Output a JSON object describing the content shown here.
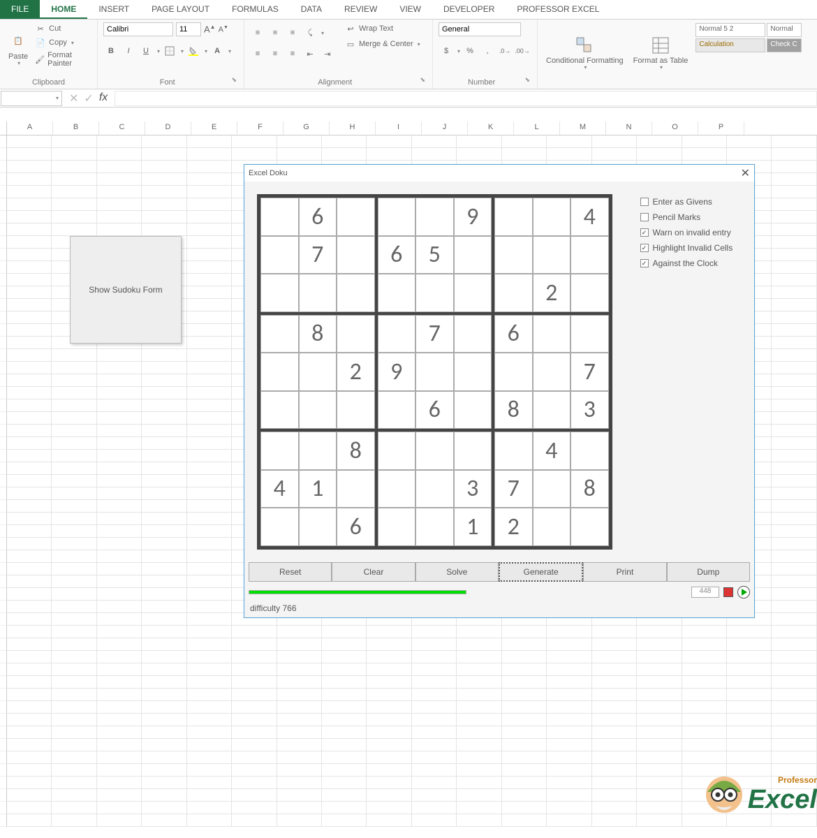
{
  "tabs": {
    "file": "FILE",
    "home": "HOME",
    "insert": "INSERT",
    "pagelayout": "PAGE LAYOUT",
    "formulas": "FORMULAS",
    "data": "DATA",
    "review": "REVIEW",
    "view": "VIEW",
    "developer": "DEVELOPER",
    "professor": "PROFESSOR EXCEL"
  },
  "clipboard": {
    "paste": "Paste",
    "cut": "Cut",
    "copy": "Copy",
    "painter": "Format Painter",
    "group": "Clipboard"
  },
  "font": {
    "name": "Calibri",
    "size": "11",
    "group": "Font"
  },
  "alignment": {
    "wrap": "Wrap Text",
    "merge": "Merge & Center",
    "group": "Alignment"
  },
  "number": {
    "format": "General",
    "group": "Number"
  },
  "styles": {
    "cf": "Conditional Formatting",
    "fat": "Format as Table",
    "s1": "Normal 5 2",
    "s2": "Normal",
    "s3": "Calculation",
    "s4": "Check C"
  },
  "columns": [
    "A",
    "B",
    "C",
    "D",
    "E",
    "F",
    "G",
    "H",
    "I",
    "J",
    "K",
    "L",
    "M",
    "N",
    "O",
    "P"
  ],
  "sheet_button": "Show Sudoku Form",
  "dialog": {
    "title": "Excel Doku",
    "options": {
      "givens": {
        "label": "Enter as Givens",
        "checked": false
      },
      "pencil": {
        "label": "Pencil Marks",
        "checked": false
      },
      "warn": {
        "label": "Warn on invalid entry",
        "checked": true
      },
      "highlight": {
        "label": "Highlight Invalid Cells",
        "checked": true
      },
      "clock": {
        "label": "Against the Clock",
        "checked": true
      }
    },
    "buttons": {
      "reset": "Reset",
      "clear": "Clear",
      "solve": "Solve",
      "generate": "Generate",
      "print": "Print",
      "dump": "Dump"
    },
    "timer": "448",
    "difficulty": "difficulty 766",
    "sudoku": [
      [
        "",
        "6",
        "",
        "",
        "",
        "9",
        "",
        "",
        "4"
      ],
      [
        "",
        "7",
        "",
        "6",
        "5",
        "",
        "",
        "",
        ""
      ],
      [
        "",
        "",
        "",
        "",
        "",
        "",
        "",
        "2",
        ""
      ],
      [
        "",
        "8",
        "",
        "",
        "7",
        "",
        "6",
        "",
        ""
      ],
      [
        "",
        "",
        "2",
        "9",
        "",
        "",
        "",
        "",
        "7"
      ],
      [
        "",
        "",
        "",
        "",
        "6",
        "",
        "8",
        "",
        "3"
      ],
      [
        "",
        "",
        "8",
        "",
        "",
        "",
        "",
        "4",
        ""
      ],
      [
        "4",
        "1",
        "",
        "",
        "",
        "3",
        "7",
        "",
        "8"
      ],
      [
        "",
        "",
        "6",
        "",
        "",
        "1",
        "2",
        "",
        ""
      ]
    ]
  },
  "logo": {
    "professor": "Professor",
    "excel": "Excel"
  }
}
